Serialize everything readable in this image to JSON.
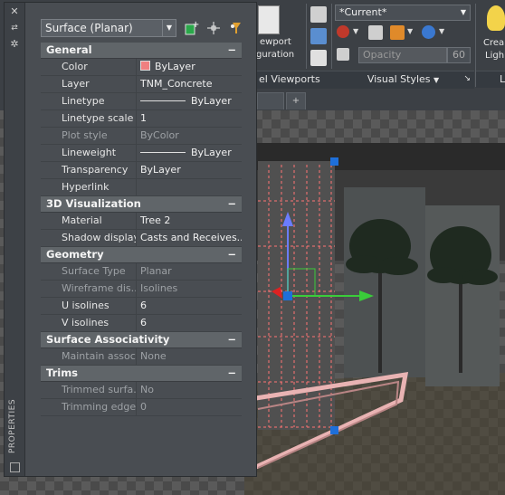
{
  "palette": {
    "title": "PROPERTIES",
    "object_type": "Surface (Planar)",
    "sections": [
      {
        "label": "General",
        "rows": [
          {
            "name": "Color",
            "value": "ByLayer",
            "kind": "color",
            "dim": false
          },
          {
            "name": "Layer",
            "value": "TNM_Concrete",
            "dim": false
          },
          {
            "name": "Linetype",
            "value": "ByLayer",
            "kind": "line",
            "dim": false
          },
          {
            "name": "Linetype scale",
            "value": "1",
            "dim": false
          },
          {
            "name": "Plot style",
            "value": "ByColor",
            "dim": true
          },
          {
            "name": "Lineweight",
            "value": "ByLayer",
            "kind": "line",
            "dim": false
          },
          {
            "name": "Transparency",
            "value": "ByLayer",
            "dim": false
          },
          {
            "name": "Hyperlink",
            "value": "",
            "dim": false
          }
        ]
      },
      {
        "label": "3D Visualization",
        "rows": [
          {
            "name": "Material",
            "value": "Tree 2",
            "dim": false
          },
          {
            "name": "Shadow display",
            "value": "Casts and Receives...",
            "dim": false
          }
        ]
      },
      {
        "label": "Geometry",
        "rows": [
          {
            "name": "Surface Type",
            "value": "Planar",
            "dim": true
          },
          {
            "name": "Wireframe dis...",
            "value": "Isolines",
            "dim": true
          },
          {
            "name": "U isolines",
            "value": "6",
            "dim": false
          },
          {
            "name": "V isolines",
            "value": "6",
            "dim": false
          }
        ]
      },
      {
        "label": "Surface Associativity",
        "rows": [
          {
            "name": "Maintain assoc...",
            "value": "None",
            "dim": true
          }
        ]
      },
      {
        "label": "Trims",
        "rows": [
          {
            "name": "Trimmed surfa...",
            "value": "No",
            "dim": true
          },
          {
            "name": "Trimming edges",
            "value": "0",
            "dim": true
          }
        ]
      }
    ]
  },
  "ribbon": {
    "viewport_config_label_1": "ewport",
    "viewport_config_label_2": "guration",
    "panel_viewports": "el Viewports",
    "visual_style": "*Current*",
    "opacity_placeholder": "Opacity",
    "opacity_value": "60",
    "panel_visual_styles": "Visual Styles",
    "create_light_1": "Crea",
    "create_light_2": "Ligh",
    "panel_lights": "L"
  },
  "colors": {
    "accent_grip": "#1e6fd9",
    "color_swatch": "#f08080"
  }
}
